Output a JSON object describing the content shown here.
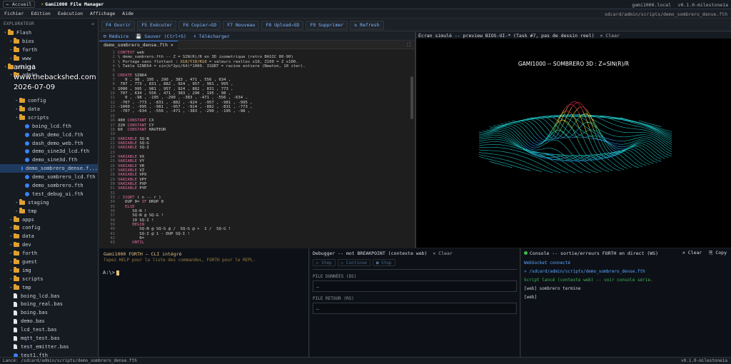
{
  "topbar": {
    "back": "← Accueil",
    "title": "Gami1000 File Manager",
    "host": "gami1000.local",
    "version": "v0.1.0-milestone1a"
  },
  "menu": [
    "Fichier",
    "Edition",
    "Exécution",
    "Affichage",
    "Aide"
  ],
  "current_path": "sdcard/admin/scripts/demo_sombrero_dense.fth",
  "sidebar": {
    "title": "EXPLORATEUR",
    "refresh": "↺",
    "tree": [
      {
        "label": "Flash",
        "type": "folder",
        "depth": 0,
        "open": true
      },
      {
        "label": "bios",
        "type": "folder",
        "depth": 1,
        "open": false
      },
      {
        "label": "forth",
        "type": "folder",
        "depth": 1,
        "open": false
      },
      {
        "label": "www",
        "type": "folder",
        "depth": 1,
        "open": false
      },
      {
        "label": "sdcard",
        "type": "folder",
        "depth": 0,
        "open": true
      },
      {
        "label": "admin",
        "type": "folder",
        "depth": 1,
        "open": true
      },
      {
        "label": "",
        "type": "hidden",
        "depth": 2
      },
      {
        "label": "",
        "type": "hidden",
        "depth": 2
      },
      {
        "label": "config",
        "type": "folder",
        "depth": 2,
        "open": false
      },
      {
        "label": "data",
        "type": "folder",
        "depth": 2,
        "open": false
      },
      {
        "label": "scripts",
        "type": "folder",
        "depth": 2,
        "open": true
      },
      {
        "label": "boing_lcd.fth",
        "type": "fth",
        "depth": 3
      },
      {
        "label": "dash_demo_lcd.fth",
        "type": "fth",
        "depth": 3
      },
      {
        "label": "dash_demo_web.fth",
        "type": "fth",
        "depth": 3
      },
      {
        "label": "demo_sine3d_lcd.fth",
        "type": "fth",
        "depth": 3
      },
      {
        "label": "demo_sine3d.fth",
        "type": "fth",
        "depth": 3
      },
      {
        "label": "demo_sombrero_dense.f...",
        "type": "fth",
        "depth": 3,
        "selected": true
      },
      {
        "label": "demo_sombrero_lcd.fth",
        "type": "fth",
        "depth": 3
      },
      {
        "label": "demo_sombrero.fth",
        "type": "fth",
        "depth": 3
      },
      {
        "label": "test_debug_ui.fth",
        "type": "fth",
        "depth": 3
      },
      {
        "label": "staging",
        "type": "folder",
        "depth": 2,
        "open": false
      },
      {
        "label": "tmp",
        "type": "folder",
        "depth": 2,
        "open": false
      },
      {
        "label": "apps",
        "type": "folder",
        "depth": 1,
        "open": false
      },
      {
        "label": "config",
        "type": "folder",
        "depth": 1,
        "open": false
      },
      {
        "label": "data",
        "type": "folder",
        "depth": 1,
        "open": false
      },
      {
        "label": "dev",
        "type": "folder",
        "depth": 1,
        "open": false
      },
      {
        "label": "forth",
        "type": "folder",
        "depth": 1,
        "open": false
      },
      {
        "label": "guest",
        "type": "folder",
        "depth": 1,
        "open": false
      },
      {
        "label": "img",
        "type": "folder",
        "depth": 1,
        "open": false
      },
      {
        "label": "scripts",
        "type": "folder",
        "depth": 1,
        "open": false
      },
      {
        "label": "tmp",
        "type": "folder",
        "depth": 1,
        "open": false
      },
      {
        "label": "boing_lcd.bas",
        "type": "bas",
        "depth": 1
      },
      {
        "label": "boing_real.bas",
        "type": "bas",
        "depth": 1
      },
      {
        "label": "boing.bas",
        "type": "bas",
        "depth": 1
      },
      {
        "label": "demo.bas",
        "type": "bas",
        "depth": 1
      },
      {
        "label": "lcd_test.bas",
        "type": "bas",
        "depth": 1
      },
      {
        "label": "mqtt_test.bas",
        "type": "bas",
        "depth": 1
      },
      {
        "label": "test_emitter.bas",
        "type": "bas",
        "depth": 1
      },
      {
        "label": "test1.fth",
        "type": "fth",
        "depth": 1
      }
    ]
  },
  "watermark": {
    "line1": "amiga",
    "line2": "www.thebackshed.com",
    "line3": "2026-07-09"
  },
  "toolbar": [
    "F4 Ouvrir",
    "F5 Exécuter",
    "F6 Copier→SD",
    "F7 Nouveau",
    "F8 Upload→SD",
    "F9 Supprimer",
    "↻ Refresh"
  ],
  "editor": {
    "actions": [
      "⊟ Réduire",
      "💾 Sauver (Ctrl+S)",
      "⬇ Télécharger"
    ],
    "tab": "demo_sombrero_dense.fth ×",
    "line_numbers": "1\n2\n3\n4\n5\n6\n7\n8\n9\n10\n11\n12\n13\n14\n15\n16\n17\n18\n19\n20\n21\n22\n23\n24\n25\n26\n27\n28\n29\n30\n31\n32\n33\n34\n35\n36\n37\n38\n39\n40\n41\n42\n43"
  },
  "preview": {
    "header": "Écran simulé -- preview BIOS-UI-* (Task #7, pas de dessin reel)",
    "clear": "✕ Clear",
    "canvas_title": "GAMI1000 -- SOMBRERO 3D : Z=SIN(R)/R"
  },
  "cli": {
    "title": "Gami1000 FORTH — CLI intégré",
    "help": "Tapez HELP pour la liste des commandes, FORTH pour le REPL.",
    "prompt": "A:\\>"
  },
  "debugger": {
    "title": "Debugger -- mot BREAKPOINT (contexte web)",
    "clear": "✕ Clear",
    "buttons": [
      "▷ Step",
      "▷ Continue",
      "■ Stop"
    ],
    "data_stack_label": "PILE DONNÉES (DS)",
    "data_stack_value": "—",
    "return_stack_label": "PILE RETOUR (RS)",
    "return_stack_value": "—"
  },
  "console": {
    "title": "Console -- sortie/erreurs FORTH en direct (WS)",
    "clear": "✕ Clear",
    "copy": "⎘ Copy",
    "lines": [
      {
        "text": "WebSocket connecté",
        "color": "#58a6ff"
      },
      {
        "text": "» /sdcard/admin/scripts/demo_sombrero_dense.fth",
        "color": "#58a6ff"
      },
      {
        "text": "Script lancé (contexte web) -- voir console série.",
        "color": "#3fb950"
      },
      {
        "text": "[web]  sombrero termine",
        "color": "#c9d1d9"
      },
      {
        "text": "[web]",
        "color": "#c9d1d9"
      }
    ]
  },
  "status": {
    "left": "Lancé: /sdcard/admin/scripts/demo_sombrero_dense.fth",
    "right": "v0.1.0-milestone1a"
  },
  "colors": {
    "accent": "#3b82f6",
    "folder": "#e0a030",
    "selection": "#1f3a5f"
  }
}
